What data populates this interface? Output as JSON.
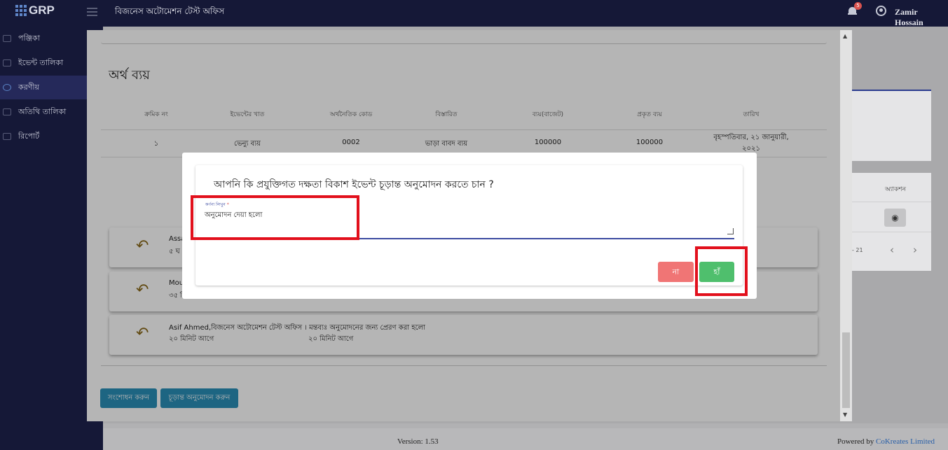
{
  "topbar": {
    "logo": "GRP",
    "office": "বিজনেস অটোমেশন টেস্ট অফিস",
    "notification_count": "5",
    "user": "Zamir Hossain"
  },
  "sidebar": {
    "items": [
      {
        "label": "পঞ্জিকা",
        "icon": "calendar-icon"
      },
      {
        "label": "ইভেন্ট তালিকা",
        "icon": "list-icon"
      },
      {
        "label": "করণীয়",
        "icon": "check-circle-icon"
      },
      {
        "label": "অতিথি তালিকা",
        "icon": "list-icon"
      },
      {
        "label": "রিপোর্ট",
        "icon": "report-icon"
      }
    ]
  },
  "background": {
    "action_header": "অ্যাকশন",
    "pagination": "- 21"
  },
  "expense": {
    "title": "অর্থ ব্যয়",
    "headers": [
      "ক্রমিক নং",
      "ইভেন্টের খাত",
      "অর্থনৈতিক কোড",
      "বিস্তারিত",
      "ব্যয়(বাজেট)",
      "প্রকৃত ব্যয়",
      "তারিখ"
    ],
    "row": [
      "১",
      "ভেন্যু ব্যয়",
      "0002",
      "ভাড়া বাবদ ব্যয়",
      "100000",
      "100000",
      "বৃহস্পতিবার, ২১ জানুয়ারী, ২০২১"
    ]
  },
  "history": [
    {
      "line1": "Assa",
      "line2": "৫ ঘ",
      "line3": ""
    },
    {
      "line1": "Mou",
      "line2": "৩৫ ি",
      "line3": ""
    },
    {
      "line1": "Asif Ahmed,বিজনেস অটোমেশন টেস্ট অফিস । মন্তব্যঃ অনুমোদনের জন্য প্রেরণ করা হলো",
      "line2": "২০ মিনিট আগে",
      "line3": "২০ মিনিট আগে"
    }
  ],
  "actions": {
    "edit": "সংশোধন করুন",
    "final_approve": "চূড়ান্ত অনুমোদন করুন"
  },
  "dialog": {
    "question": "আপনি কি প্রযুক্তিগত দক্ষতা বিকাশ ইভেন্ট চূড়ান্ত অনুমোদন করতে চান ?",
    "field_label": "কর্ণনা লিখুন",
    "field_required": "*",
    "field_value": "অনুমোদন দেয়া হলো",
    "no": "না",
    "yes": "হাঁ"
  },
  "footer": {
    "version": "Version: 1.53",
    "powered_prefix": "Powered by",
    "powered_brand": "CoKreates Limited"
  },
  "colors": {
    "navy": "#151837",
    "primary_blue": "#2a8fb7",
    "yes_green": "#4fbf6d",
    "no_red": "#f07575",
    "highlight_red": "#e2101c"
  }
}
